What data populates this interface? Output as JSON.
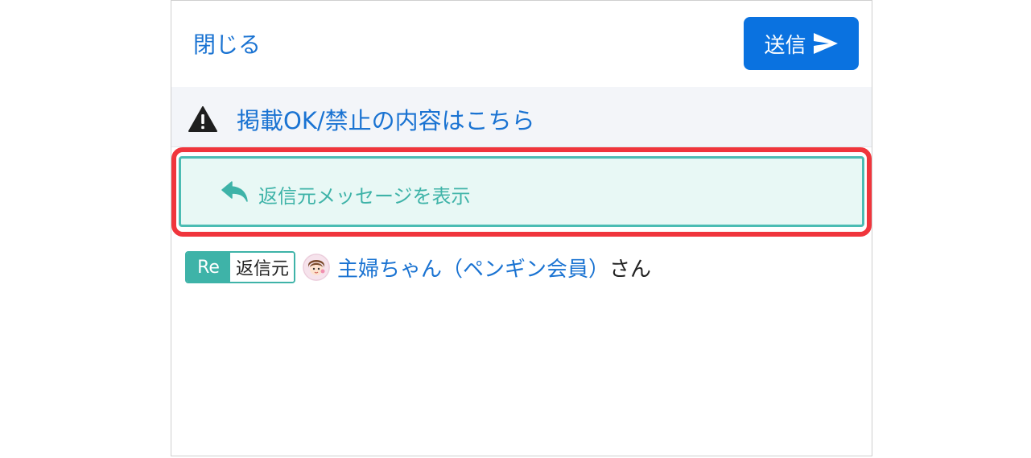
{
  "header": {
    "close_label": "閉じる",
    "send_label": "送信"
  },
  "notice": {
    "link_label": "掲載OK/禁止の内容はこちら"
  },
  "reply": {
    "show_source_label": "返信元メッセージを表示"
  },
  "source": {
    "badge_re": "Re",
    "badge_label": "返信元",
    "user_name": "主婦ちゃん（ペンギン会員）",
    "honorific": "さん"
  },
  "colors": {
    "primary": "#0a72e0",
    "link": "#1a73d2",
    "teal": "#3eb3a8",
    "highlight": "#f0353c"
  },
  "icons": {
    "send": "send-icon",
    "warning": "warning-icon",
    "reply": "reply-icon",
    "avatar": "avatar-icon"
  }
}
